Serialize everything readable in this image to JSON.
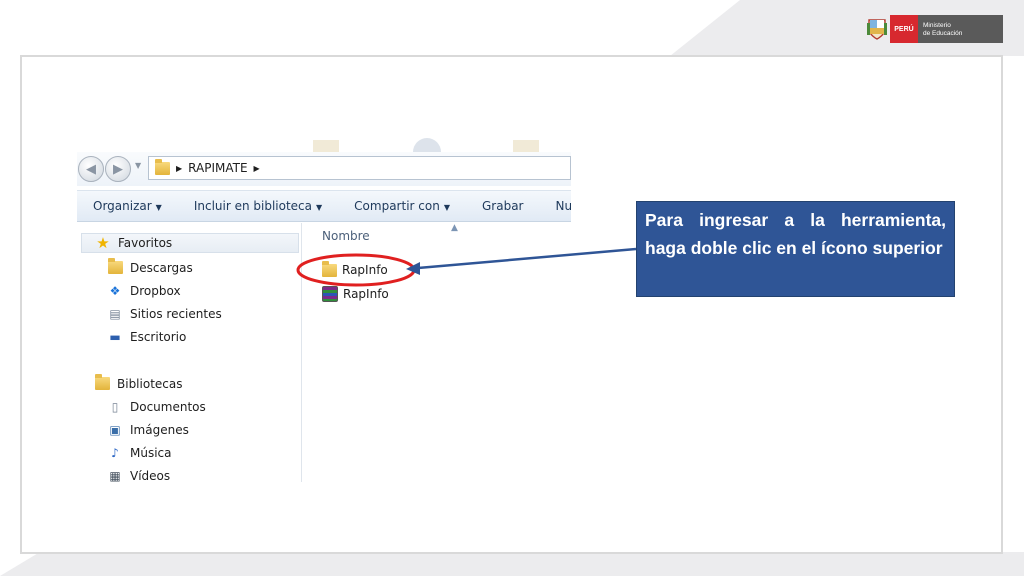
{
  "logo": {
    "country": "PERÚ",
    "ministry_line1": "Ministerio",
    "ministry_line2": "de Educación"
  },
  "explorer": {
    "breadcrumb": "RAPIMATE",
    "toolbar": {
      "organize": "Organizar",
      "include_library": "Incluir en biblioteca",
      "share": "Compartir con",
      "burn": "Grabar",
      "new_partial": "Nue"
    },
    "nav": {
      "favorites": "Favoritos",
      "favorites_items": [
        "Descargas",
        "Dropbox",
        "Sitios recientes",
        "Escritorio"
      ],
      "libraries": "Bibliotecas",
      "libraries_items": [
        "Documentos",
        "Imágenes",
        "Música",
        "Vídeos"
      ]
    },
    "column_header": "Nombre",
    "files": [
      {
        "name": "RapInfo",
        "icon": "folder-icon"
      },
      {
        "name": "RapInfo",
        "icon": "winrar-archive-icon"
      }
    ]
  },
  "callout": {
    "text": "Para ingresar a la herramienta, haga doble clic en el ícono superior"
  },
  "colors": {
    "callout_bg": "#2f5596",
    "highlight_ellipse": "#e02020",
    "arrow": "#2f5596"
  }
}
